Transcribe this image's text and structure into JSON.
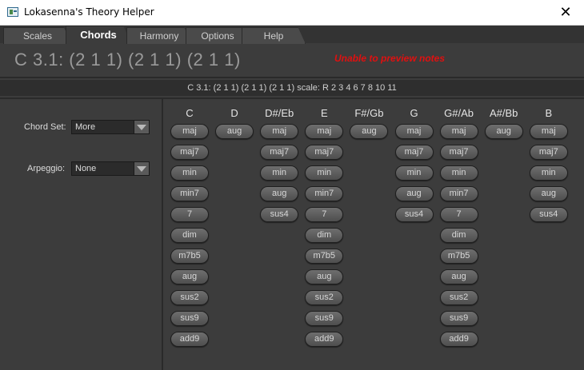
{
  "window": {
    "title": "Lokasenna's Theory Helper"
  },
  "tabs": [
    "Scales",
    "Chords",
    "Harmony",
    "Options",
    "Help"
  ],
  "active_tab": "Chords",
  "warning": "Unable to preview notes",
  "chord_display": "C 3.1: (2  1  1)  (2  1  1)  (2  1  1)",
  "scale_line": "C 3.1: (2  1  1)  (2  1  1)  (2  1  1) scale:  R 2 3 4 6 7 8 10 11",
  "left": {
    "chord_set_label": "Chord Set:",
    "chord_set_value": "More",
    "arpeggio_label": "Arpeggio:",
    "arpeggio_value": "None"
  },
  "columns": [
    {
      "root": "C",
      "chords": [
        "maj",
        "maj7",
        "min",
        "min7",
        "7",
        "dim",
        "m7b5",
        "aug",
        "sus2",
        "sus9",
        "add9"
      ]
    },
    {
      "root": "D",
      "chords": [
        "aug"
      ]
    },
    {
      "root": "D#/Eb",
      "chords": [
        "maj",
        "maj7",
        "min",
        "aug",
        "sus4"
      ]
    },
    {
      "root": "E",
      "chords": [
        "maj",
        "maj7",
        "min",
        "min7",
        "7",
        "dim",
        "m7b5",
        "aug",
        "sus2",
        "sus9",
        "add9"
      ]
    },
    {
      "root": "F#/Gb",
      "chords": [
        "aug"
      ]
    },
    {
      "root": "G",
      "chords": [
        "maj",
        "maj7",
        "min",
        "aug",
        "sus4"
      ]
    },
    {
      "root": "G#/Ab",
      "chords": [
        "maj",
        "maj7",
        "min",
        "min7",
        "7",
        "dim",
        "m7b5",
        "aug",
        "sus2",
        "sus9",
        "add9"
      ]
    },
    {
      "root": "A#/Bb",
      "chords": [
        "aug"
      ]
    },
    {
      "root": "B",
      "chords": [
        "maj",
        "maj7",
        "min",
        "aug",
        "sus4"
      ]
    }
  ],
  "colors": {
    "warning": "#e01010",
    "background": "#3c3c3c"
  },
  "icons": {
    "app": "app-icon",
    "close": "close-icon",
    "dropdown": "chevron-down-icon"
  }
}
